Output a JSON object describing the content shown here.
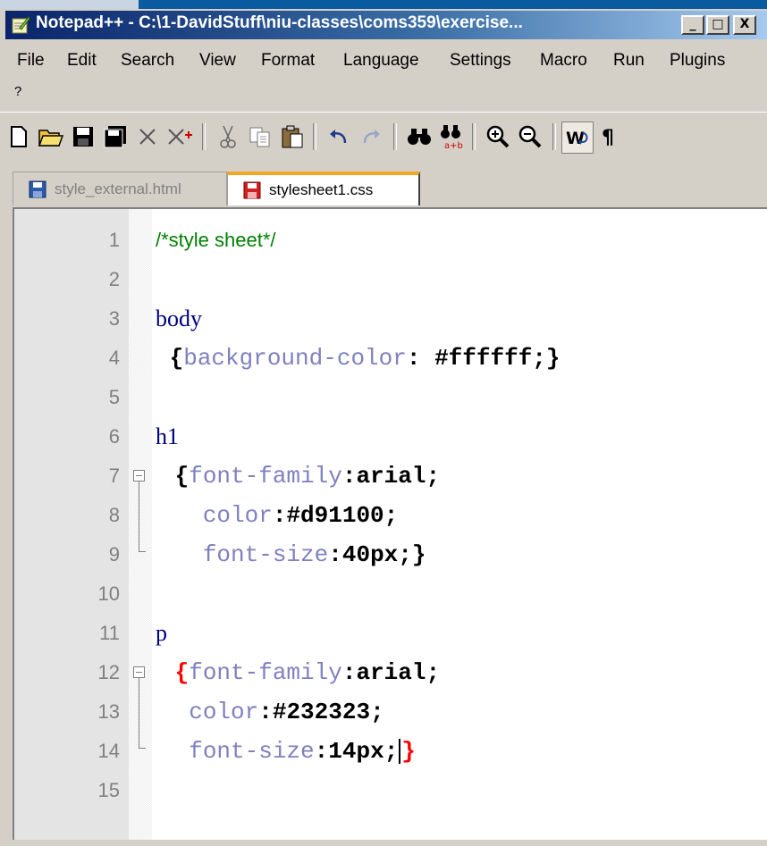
{
  "window": {
    "title": "Notepad++ - C:\\1-DavidStuff\\niu-classes\\coms359\\exercise...",
    "minimize": "_",
    "maximize": "□",
    "close": "X"
  },
  "menu": {
    "items": [
      "File",
      "Edit",
      "Search",
      "View",
      "Format",
      "Language",
      "Settings",
      "Macro",
      "Run",
      "Plugins"
    ],
    "overflow": "?"
  },
  "toolbar": {
    "icons": [
      "new-file-icon",
      "open-file-icon",
      "save-icon",
      "save-all-icon",
      "close-icon",
      "close-all-icon",
      "cut-icon",
      "copy-icon",
      "paste-icon",
      "undo-icon",
      "redo-icon",
      "find-icon",
      "replace-icon",
      "zoom-in-icon",
      "zoom-out-icon",
      "word-wrap-icon",
      "show-all-chars-icon"
    ]
  },
  "tabs": [
    {
      "label": "style_external.html",
      "active": false
    },
    {
      "label": "stylesheet1.css",
      "active": true
    }
  ],
  "editor": {
    "lines": [
      {
        "num": "1",
        "text": "/*style sheet*/"
      },
      {
        "num": "2",
        "text": ""
      },
      {
        "num": "3",
        "text": "body"
      },
      {
        "num": "4",
        "text": " {background-color: #ffffff;}"
      },
      {
        "num": "5",
        "text": ""
      },
      {
        "num": "6",
        "text": "h1"
      },
      {
        "num": "7",
        "text": " {font-family:arial;"
      },
      {
        "num": "8",
        "text": "   color:#d91100;"
      },
      {
        "num": "9",
        "text": "   font-size:40px;}"
      },
      {
        "num": "10",
        "text": ""
      },
      {
        "num": "11",
        "text": "p"
      },
      {
        "num": "12",
        "text": " {font-family:arial;"
      },
      {
        "num": "13",
        "text": "  color:#232323;"
      },
      {
        "num": "14",
        "text": "  font-size:14px;}"
      },
      {
        "num": "15",
        "text": ""
      }
    ]
  },
  "colors": {
    "comment": "#008000",
    "selector": "#000080",
    "property": "#8080c0",
    "value": "#000000",
    "brace_match": "#ff0000",
    "active_tab_accent": "#f5a623"
  }
}
